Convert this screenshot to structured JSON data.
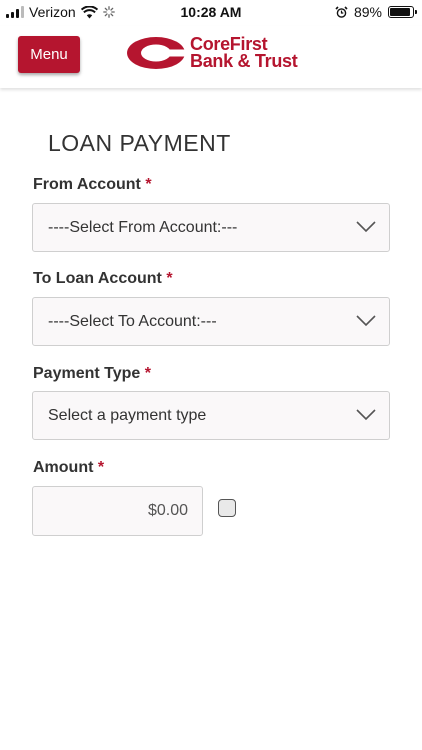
{
  "status_bar": {
    "carrier": "Verizon",
    "time": "10:28 AM",
    "battery_percent": "89%",
    "battery_level": 0.89
  },
  "header": {
    "menu_label": "Menu",
    "logo_line1": "CoreFirst",
    "logo_line2": "Bank & Trust",
    "brand_color": "#b5152f"
  },
  "form": {
    "title": "LOAN PAYMENT",
    "required_marker": "*",
    "from_account": {
      "label": "From Account",
      "value": "----Select From Account:---"
    },
    "to_account": {
      "label": "To Loan Account",
      "value": "----Select To Account:---"
    },
    "payment_type": {
      "label": "Payment Type",
      "value": "Select a payment type"
    },
    "amount": {
      "label": "Amount",
      "value": "$0.00"
    }
  }
}
